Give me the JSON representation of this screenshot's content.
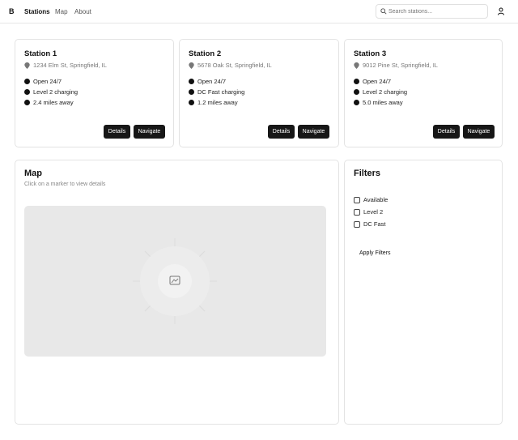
{
  "nav": {
    "logo": "B",
    "links": [
      "Stations",
      "Map",
      "About"
    ],
    "active": "Stations"
  },
  "search": {
    "placeholder": "Search stations..."
  },
  "stations": [
    {
      "name": "Station 1",
      "address": "1234 Elm St, Springfield, IL",
      "features": [
        "Open 24/7",
        "Level 2 charging",
        "2.4 miles away"
      ],
      "details_label": "Details",
      "navigate_label": "Navigate"
    },
    {
      "name": "Station 2",
      "address": "5678 Oak St, Springfield, IL",
      "features": [
        "Open 24/7",
        "DC Fast charging",
        "1.2 miles away"
      ],
      "details_label": "Details",
      "navigate_label": "Navigate"
    },
    {
      "name": "Station 3",
      "address": "9012 Pine St, Springfield, IL",
      "features": [
        "Open 24/7",
        "Level 2 charging",
        "5.0 miles away"
      ],
      "details_label": "Details",
      "navigate_label": "Navigate"
    }
  ],
  "map": {
    "title": "Map",
    "subtitle": "Click on a marker to view details"
  },
  "filters": {
    "title": "Filters",
    "options": [
      "Available",
      "Level 2",
      "DC Fast"
    ],
    "apply_label": "Apply Filters"
  },
  "colors": {
    "button_bg": "#171717",
    "border": "#e3e3e3",
    "map_bg": "#e8e8e8"
  }
}
